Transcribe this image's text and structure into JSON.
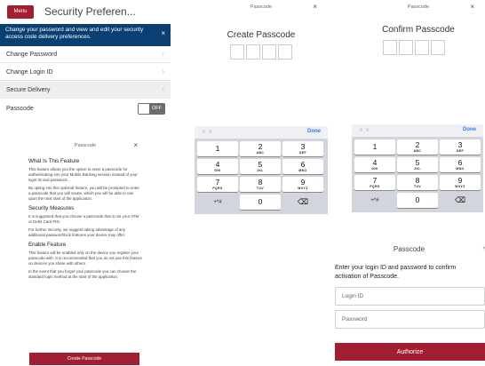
{
  "security": {
    "menu_label": "Menu",
    "title": "Security Preferen...",
    "banner_text": "Change your password and view and edit your security access code delivery preferences.",
    "banner_close": "×",
    "rows": [
      {
        "label": "Change Password"
      },
      {
        "label": "Change Login ID"
      },
      {
        "label": "Secure Delivery"
      }
    ],
    "passcode_label": "Passcode",
    "toggle_label": "OFF"
  },
  "about": {
    "header": "Passcode",
    "close": "×",
    "sections": [
      {
        "heading": "What Is This Feature",
        "paragraphs": [
          "This feature allows you the option to enter a passcode for authenticating into your Mobile Banking session instead of your login ID and password.",
          "By opting into this optional feature, you will be prompted to enter a passcode that you will create, which you will be able to use upon the next start of the application."
        ]
      },
      {
        "heading": "Security Measures",
        "paragraphs": [
          "It is suggested that you choose a passcode that is not your ATM or Debit Card PIN.",
          "For further security, we suggest taking advantage of any additional password/lock features your device may offer."
        ]
      },
      {
        "heading": "Enable Feature",
        "paragraphs": [
          "This feature will be enabled only on the device you register your passcode with. It is recommended that you do not use this feature on devices you share with others.",
          "In the event that you forget your passcode you can choose the standard login method at the start of the application."
        ]
      }
    ],
    "button_label": "Create Passcode"
  },
  "create": {
    "header": "Passcode",
    "close": "×",
    "title": "Create Passcode"
  },
  "confirm": {
    "header": "Passcode",
    "close": "×",
    "title": "Confirm Passcode"
  },
  "keyboard": {
    "arrows": "∧ ∨",
    "done": "Done",
    "keys": [
      {
        "digit": "1",
        "letters": ""
      },
      {
        "digit": "2",
        "letters": "ABC"
      },
      {
        "digit": "3",
        "letters": "DEF"
      },
      {
        "digit": "4",
        "letters": "GHI"
      },
      {
        "digit": "5",
        "letters": "JKL"
      },
      {
        "digit": "6",
        "letters": "MNO"
      },
      {
        "digit": "7",
        "letters": "PQRS"
      },
      {
        "digit": "8",
        "letters": "TUV"
      },
      {
        "digit": "9",
        "letters": "WXYZ"
      },
      {
        "digit": "+*#",
        "letters": ""
      },
      {
        "digit": "0",
        "letters": ""
      },
      {
        "digit": "⌫",
        "letters": ""
      }
    ]
  },
  "login": {
    "header": "Passcode",
    "close": "›",
    "intro": "Enter your login ID and password to confirm activation of Passcode.",
    "login_placeholder": "Login ID",
    "password_placeholder": "Password",
    "button_label": "Authorize"
  },
  "colors": {
    "brand_red": "#a11e33",
    "banner_navy": "#0b3f73",
    "keyboard_gray": "#d2d5db",
    "link_blue": "#3478f6"
  }
}
